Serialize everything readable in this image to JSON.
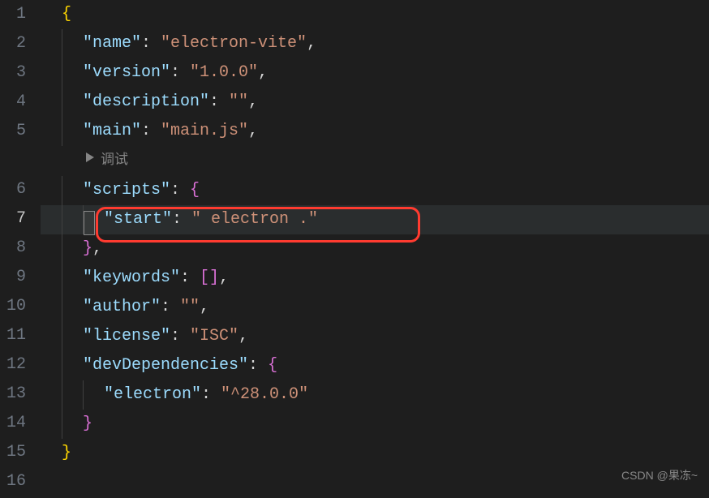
{
  "lineNumbers": [
    "1",
    "2",
    "3",
    "4",
    "5",
    "6",
    "7",
    "8",
    "9",
    "10",
    "11",
    "12",
    "13",
    "14",
    "15",
    "16"
  ],
  "activeLine": "7",
  "debugHint": "调试",
  "watermark": "CSDN @果冻~",
  "code": {
    "name_key": "\"name\"",
    "name_val": "\"electron-vite\"",
    "version_key": "\"version\"",
    "version_val": "\"1.0.0\"",
    "description_key": "\"description\"",
    "description_val": "\"\"",
    "main_key": "\"main\"",
    "main_val": "\"main.js\"",
    "scripts_key": "\"scripts\"",
    "start_key": "\"start\"",
    "start_val": "\" electron .\"",
    "keywords_key": "\"keywords\"",
    "author_key": "\"author\"",
    "author_val": "\"\"",
    "license_key": "\"license\"",
    "license_val": "\"ISC\"",
    "devdeps_key": "\"devDependencies\"",
    "electron_key": "\"electron\"",
    "electron_val": "\"^28.0.0\""
  }
}
